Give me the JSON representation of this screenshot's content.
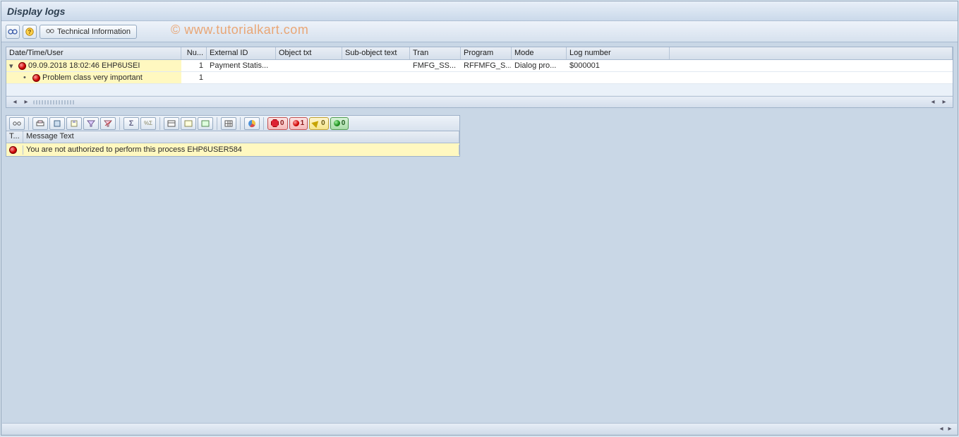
{
  "title": "Display logs",
  "watermark": "© www.tutorialkart.com",
  "top_toolbar": {
    "tech_info": "Technical Information"
  },
  "grid": {
    "columns": {
      "date": "Date/Time/User",
      "nu": "Nu...",
      "ext": "External ID",
      "obj": "Object txt",
      "sub": "Sub-object text",
      "tran": "Tran",
      "prog": "Program",
      "mode": "Mode",
      "log": "Log number"
    },
    "rows": [
      {
        "level": 0,
        "expanded": true,
        "date": "09.09.2018  18:02:46  EHP6USEI",
        "nu": "1",
        "ext": "Payment Statis...",
        "obj": "",
        "sub": "",
        "tran": "FMFG_SS...",
        "prog": "RFFMFG_S...",
        "mode": "Dialog pro...",
        "log": "$000001"
      },
      {
        "level": 1,
        "expanded": false,
        "date": "Problem class very important",
        "nu": "1",
        "ext": "",
        "obj": "",
        "sub": "",
        "tran": "",
        "prog": "",
        "mode": "",
        "log": ""
      }
    ]
  },
  "badges": {
    "stop": "0",
    "red": "1",
    "yellow": "0",
    "green": "0"
  },
  "msg": {
    "columns": {
      "type": "T...",
      "text": "Message Text"
    },
    "row": {
      "text": "You are not authorized to perform this process EHP6USER584"
    }
  }
}
